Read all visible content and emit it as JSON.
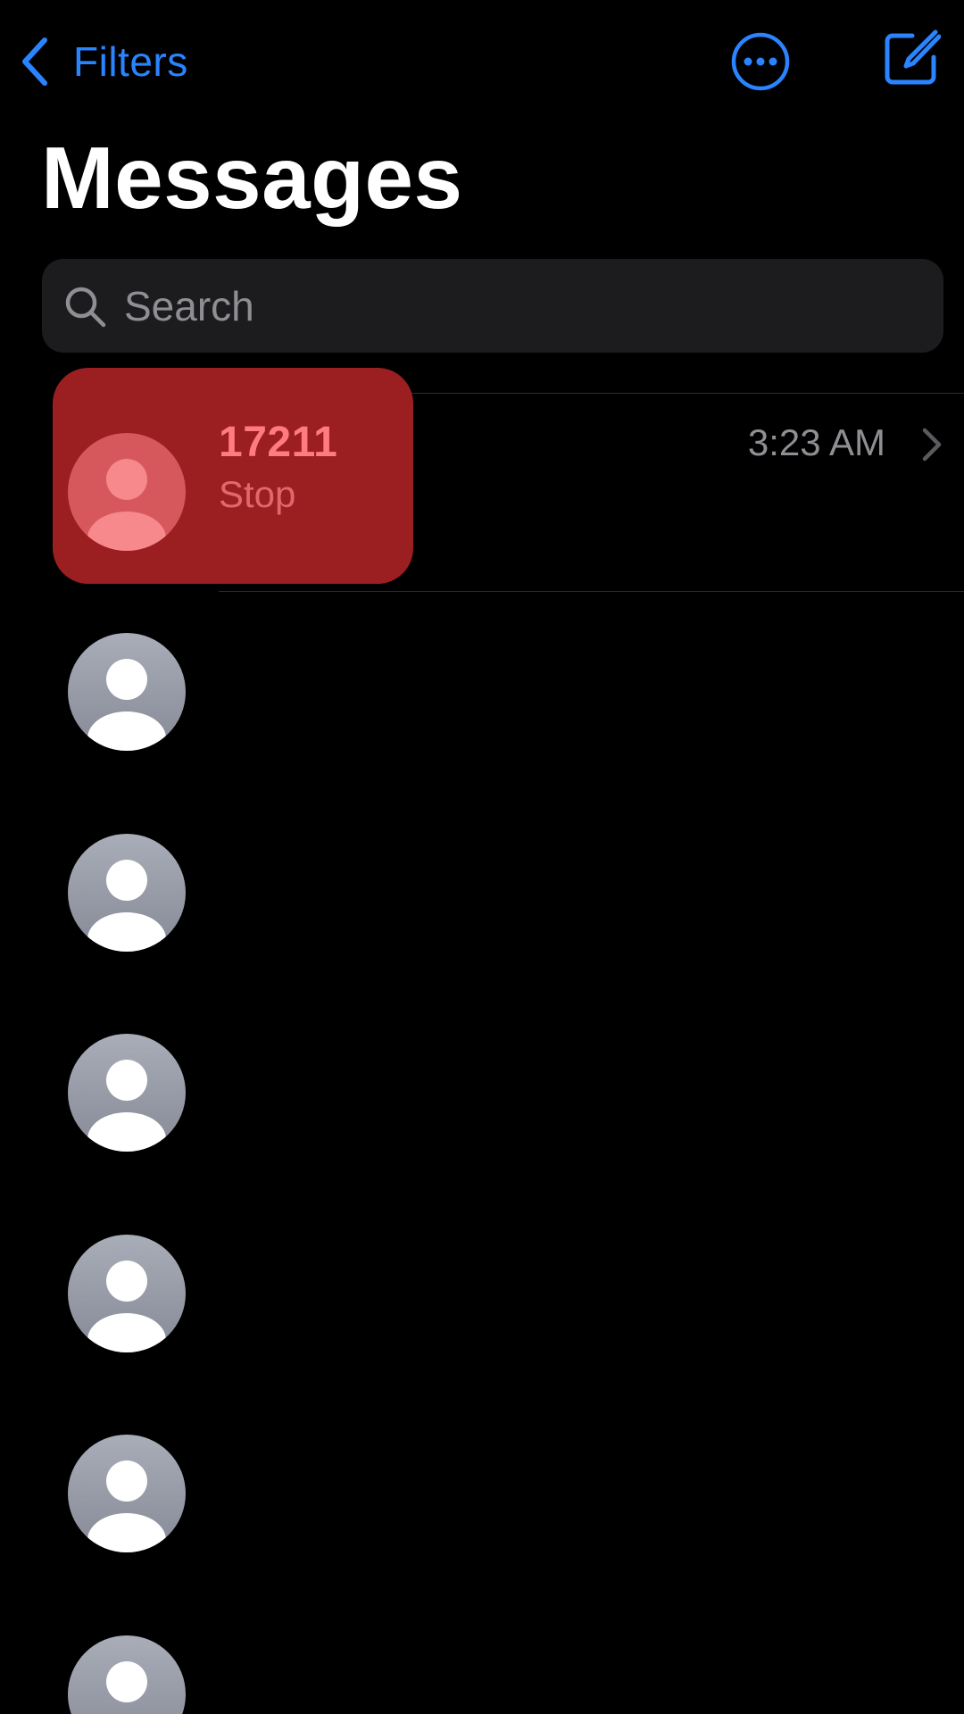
{
  "nav": {
    "back_label": "Filters",
    "back_icon": "chevron-left-icon",
    "more_icon": "ellipsis-circle-icon",
    "compose_icon": "compose-icon"
  },
  "title": "Messages",
  "search": {
    "placeholder": "Search",
    "value": ""
  },
  "conversations": [
    {
      "sender": "17211",
      "preview": "Stop",
      "time": "3:23 AM",
      "highlighted": true
    }
  ],
  "colors": {
    "accent": "#2a84ff",
    "background": "#000000",
    "search_bg": "#1c1c1e",
    "highlight": "#9b1e21",
    "secondary_text": "#8e8e93"
  }
}
